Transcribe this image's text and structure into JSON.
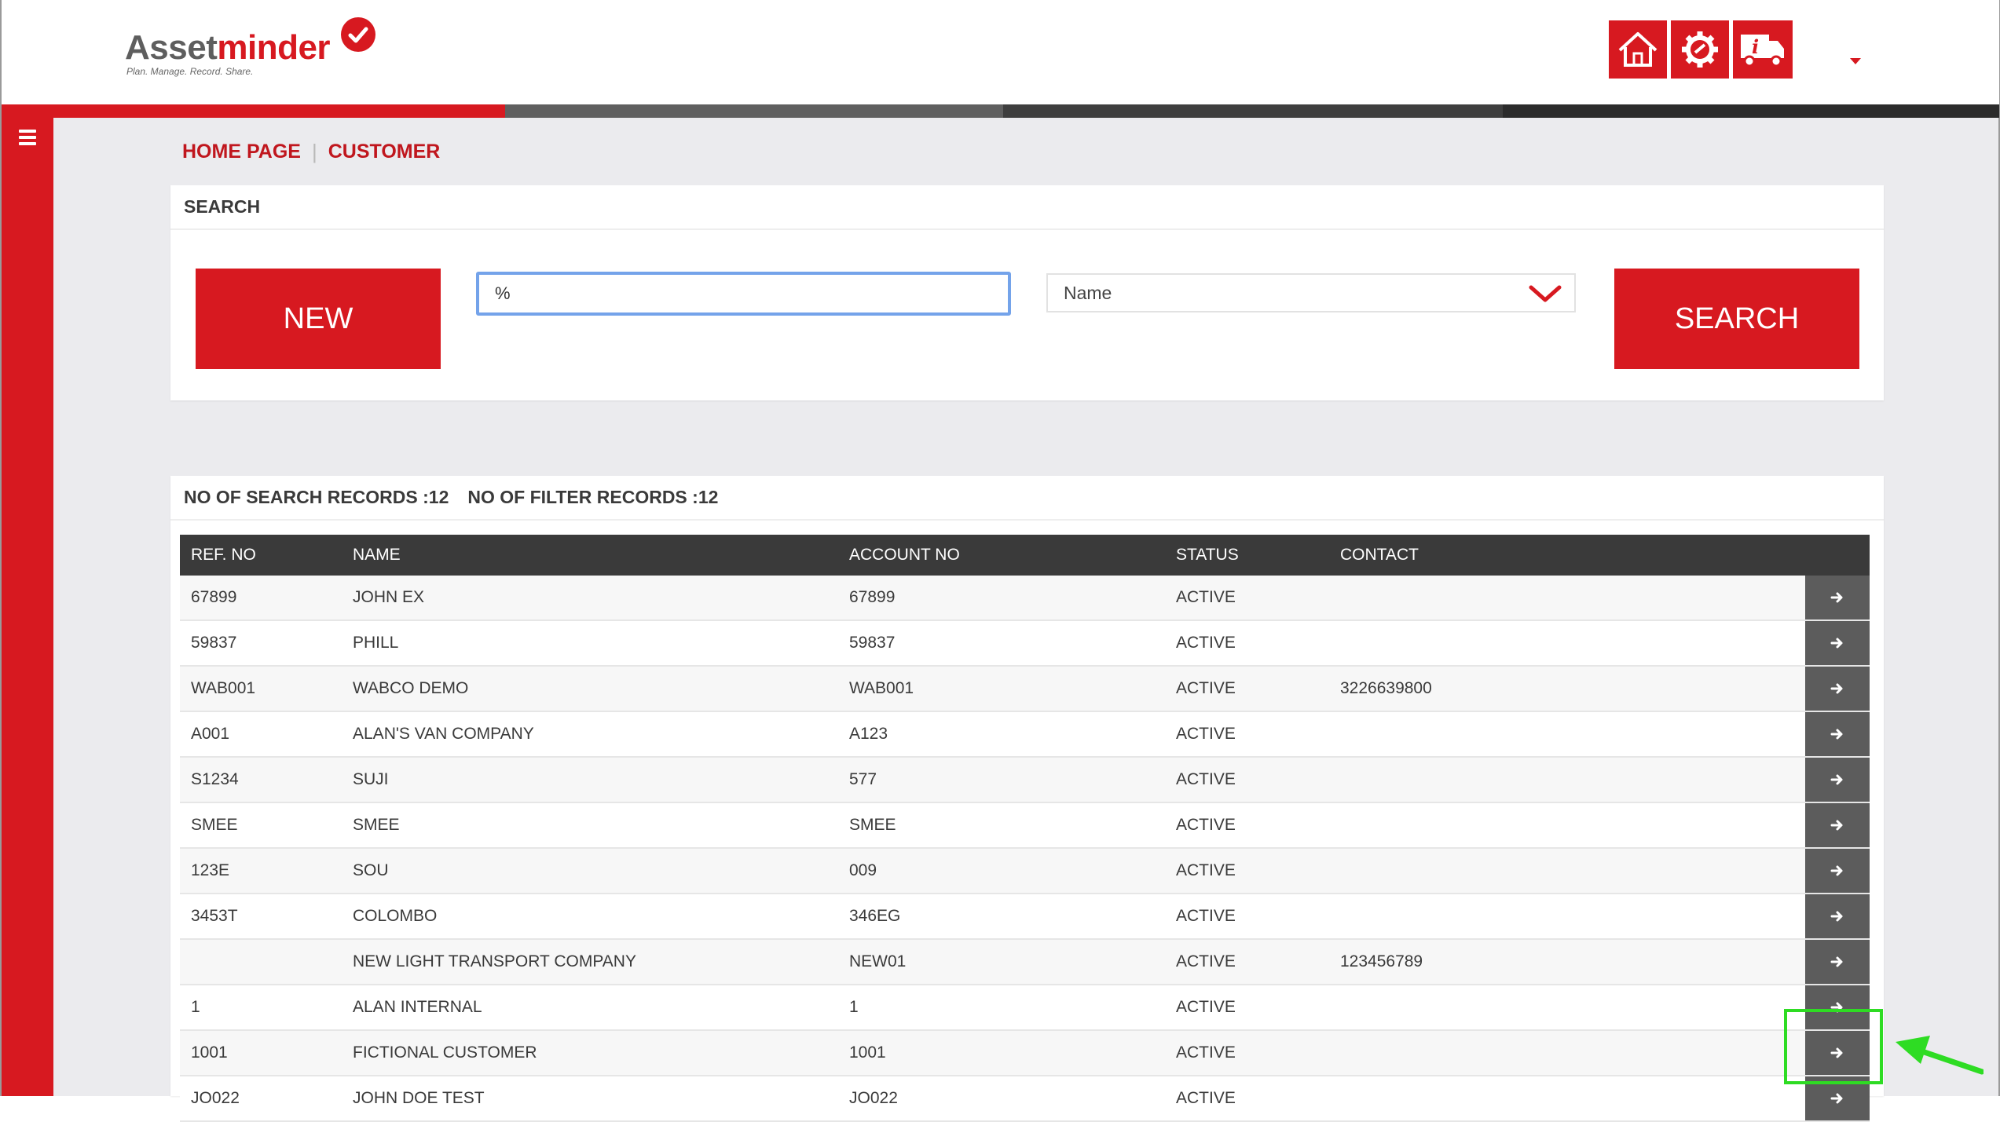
{
  "brand": {
    "name_part1": "Asset",
    "name_part2": "minder",
    "tagline": "Plan. Manage. Record. Share.",
    "accent_color": "#d71920"
  },
  "header": {
    "icons": [
      "home-icon",
      "settings-icon",
      "vehicle-info-icon"
    ]
  },
  "breadcrumb": {
    "home": "HOME PAGE",
    "separator": "|",
    "current": "CUSTOMER"
  },
  "search": {
    "title": "SEARCH",
    "new_label": "NEW",
    "search_label": "SEARCH",
    "query_value": "%",
    "field_selected": "Name"
  },
  "results": {
    "search_count_text": "NO OF SEARCH RECORDS :12",
    "filter_count_text": "NO OF FILTER RECORDS :12",
    "columns": [
      "REF. NO",
      "NAME",
      "ACCOUNT NO",
      "STATUS",
      "CONTACT"
    ],
    "rows": [
      {
        "ref": "67899",
        "name": "JOHN EX",
        "account": "67899",
        "status": "ACTIVE",
        "contact": ""
      },
      {
        "ref": "59837",
        "name": "PHILL",
        "account": "59837",
        "status": "ACTIVE",
        "contact": ""
      },
      {
        "ref": "WAB001",
        "name": "WABCO DEMO",
        "account": "WAB001",
        "status": "ACTIVE",
        "contact": "3226639800"
      },
      {
        "ref": "A001",
        "name": "ALAN'S VAN COMPANY",
        "account": "A123",
        "status": "ACTIVE",
        "contact": ""
      },
      {
        "ref": "S1234",
        "name": "SUJI",
        "account": "577",
        "status": "ACTIVE",
        "contact": ""
      },
      {
        "ref": "SMEE",
        "name": "SMEE",
        "account": "SMEE",
        "status": "ACTIVE",
        "contact": ""
      },
      {
        "ref": "123E",
        "name": "SOU",
        "account": "009",
        "status": "ACTIVE",
        "contact": ""
      },
      {
        "ref": "3453T",
        "name": "COLOMBO",
        "account": "346EG",
        "status": "ACTIVE",
        "contact": ""
      },
      {
        "ref": "",
        "name": "NEW LIGHT TRANSPORT COMPANY",
        "account": "NEW01",
        "status": "ACTIVE",
        "contact": "123456789"
      },
      {
        "ref": "1",
        "name": "ALAN INTERNAL",
        "account": "1",
        "status": "ACTIVE",
        "contact": ""
      },
      {
        "ref": "1001",
        "name": "FICTIONAL CUSTOMER",
        "account": "1001",
        "status": "ACTIVE",
        "contact": ""
      },
      {
        "ref": "JO022",
        "name": "JOHN DOE TEST",
        "account": "JO022",
        "status": "ACTIVE",
        "contact": ""
      }
    ]
  },
  "annotation": {
    "highlight_color": "#2edc23"
  }
}
